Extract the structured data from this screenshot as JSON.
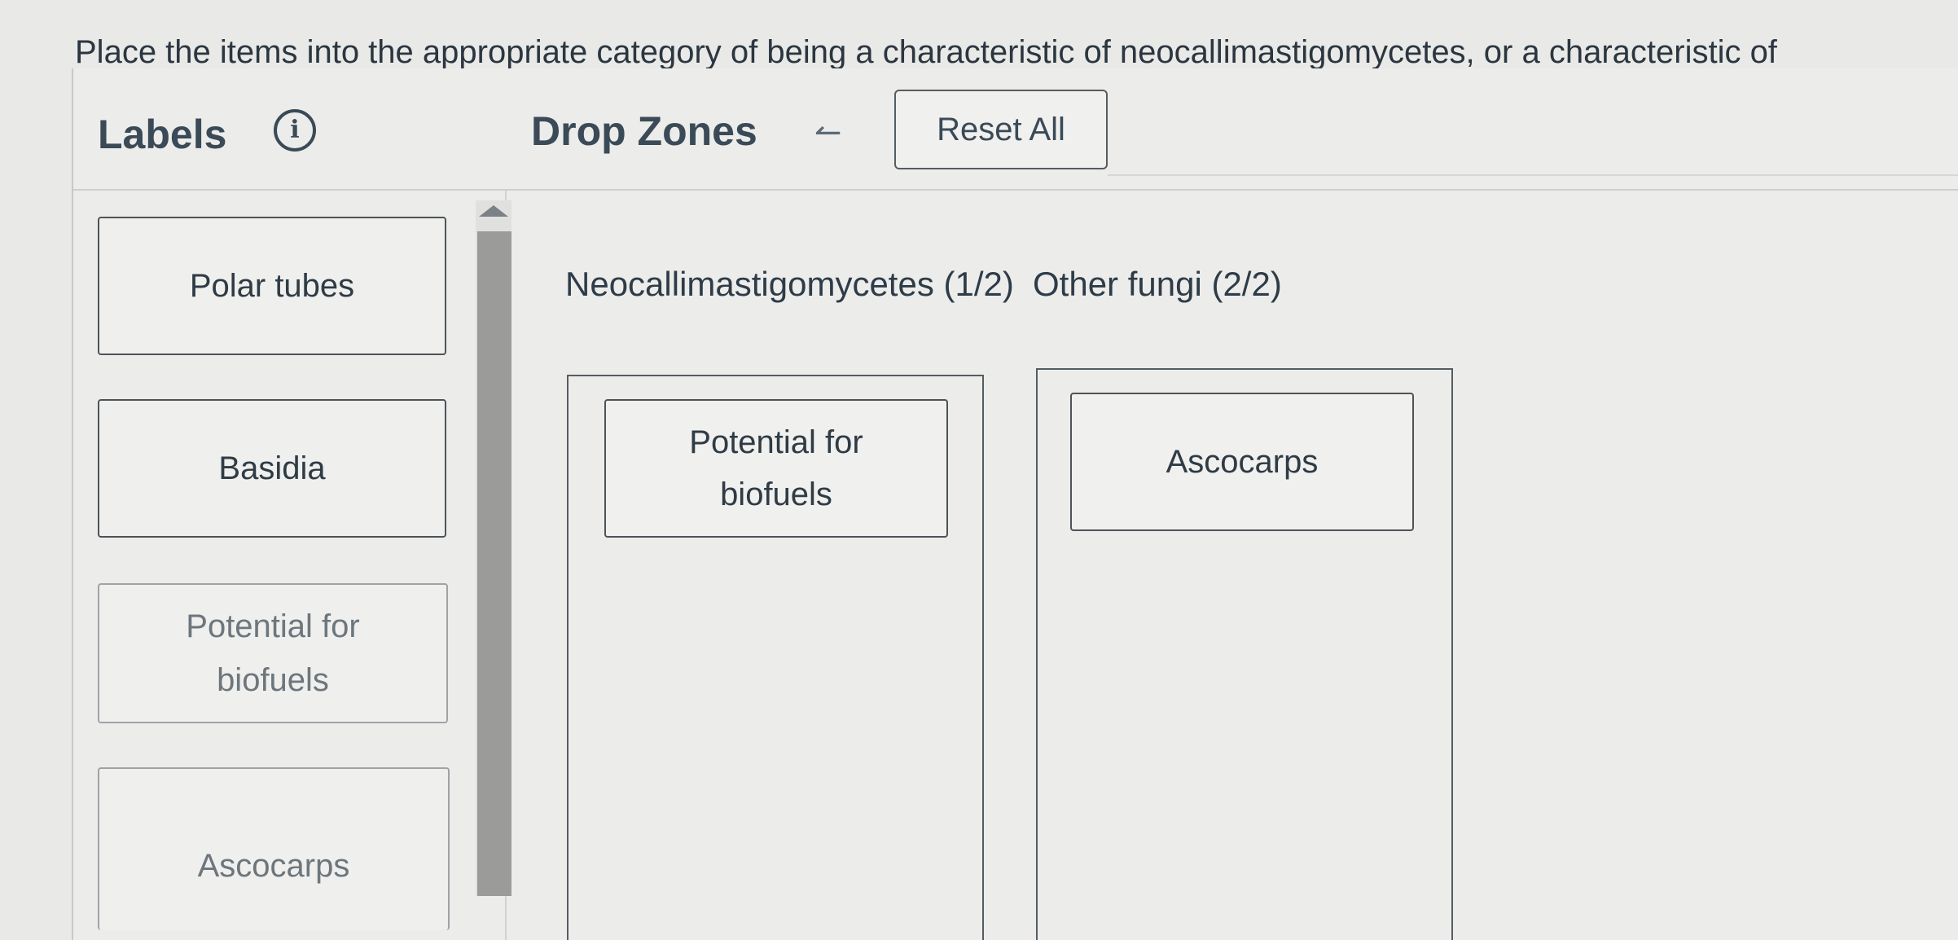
{
  "instructions": "Place the items into the appropriate category of being a characteristic of neocallimastigomycetes, or a characteristic of",
  "header": {
    "labels_title": "Labels",
    "drop_zones_title": "Drop Zones",
    "reset_label": "Reset All",
    "info_icon": "info-icon",
    "undo_icon": "undo-arrow-icon"
  },
  "labels": [
    {
      "text": "Polar tubes",
      "placed": false
    },
    {
      "text": "Basidia",
      "placed": false
    },
    {
      "text": "Potential for biofuels",
      "placed": true
    },
    {
      "text": "Ascocarps",
      "placed": true
    }
  ],
  "drop_zones": [
    {
      "title": "Neocallimastigomycetes (1/2)",
      "items": [
        "Potential for biofuels"
      ]
    },
    {
      "title": "Other fungi (2/2)",
      "items": [
        "Ascocarps"
      ]
    }
  ]
}
